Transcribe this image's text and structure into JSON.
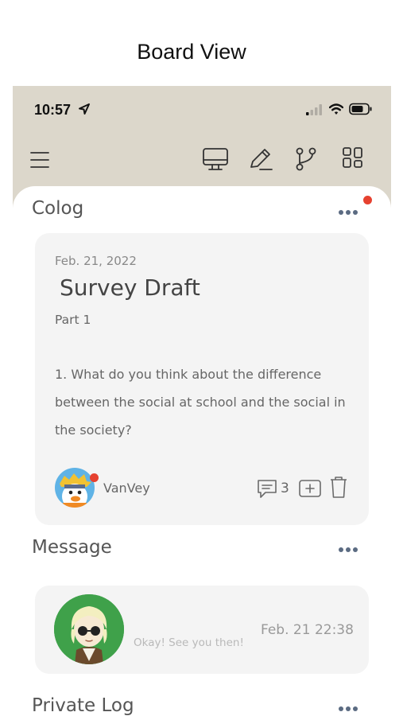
{
  "page": {
    "title": "Board View"
  },
  "status_bar": {
    "time": "10:57"
  },
  "toolbar": {
    "icons": [
      "menu-icon",
      "monitor-icon",
      "pencil-icon",
      "branch-icon",
      "grid-icon"
    ]
  },
  "colog": {
    "title": "Colog",
    "has_notification": true,
    "card": {
      "date": "Feb. 21, 2022",
      "title": "Survey Draft",
      "subtitle": "Part 1",
      "body": "1. What do you think about the difference between the social at school and the social in the society?",
      "author": "VanVey",
      "comment_count": "3",
      "author_online": true
    }
  },
  "message": {
    "title": "Message",
    "preview": "Okay! See you then!",
    "time": "Feb. 21 22:38"
  },
  "private_log": {
    "title": "Private Log"
  },
  "colors": {
    "header_bg": "#dcd7cb",
    "card_bg": "#f4f4f4",
    "notification": "#e6412f",
    "more_dots": "#5b6b82",
    "avatar_bg": "#3fa14a"
  }
}
